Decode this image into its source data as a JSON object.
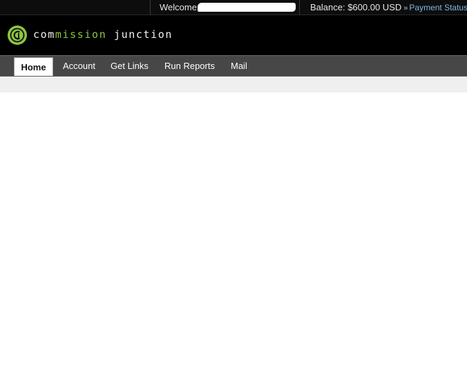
{
  "topbar": {
    "welcome_label": "Welcome",
    "balance_text": "Balance: $600.00 USD",
    "raquo": "»",
    "payment_status_link": "Payment Status"
  },
  "header": {
    "logo_part1": "com",
    "logo_part2": "mission",
    "logo_part3": " junction"
  },
  "nav": {
    "tabs": [
      {
        "label": "Home",
        "active": true
      },
      {
        "label": "Account"
      },
      {
        "label": "Get Links"
      },
      {
        "label": "Run Reports"
      },
      {
        "label": "Mail"
      }
    ]
  },
  "colors": {
    "brand_green": "#8dc63f",
    "link_blue": "#7fb8e6",
    "nav_bg": "#474747",
    "header_bg": "#000000"
  }
}
